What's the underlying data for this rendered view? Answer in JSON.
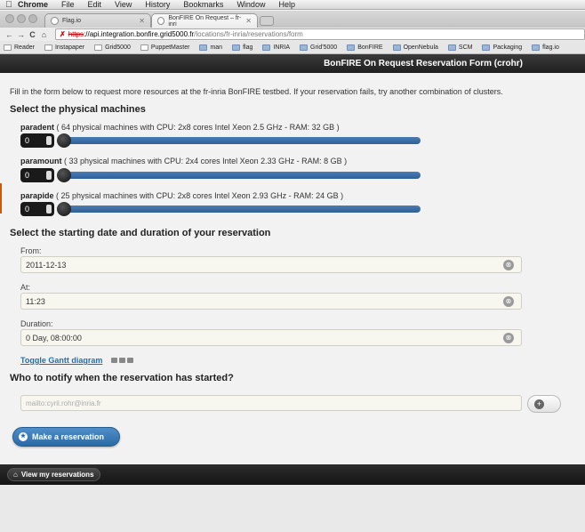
{
  "menubar": {
    "app": "Chrome",
    "items": [
      "File",
      "Edit",
      "View",
      "History",
      "Bookmarks",
      "Window",
      "Help"
    ]
  },
  "tabs": [
    {
      "label": "Flag.io",
      "active": false
    },
    {
      "label": "BonFIRE On Request – fr-inri",
      "active": true
    }
  ],
  "address": {
    "scheme": "https",
    "host": "://api.integration.bonfire.grid5000.fr",
    "path": "/locations/fr-inria/reservations/form"
  },
  "bookmarks": [
    {
      "label": "Reader",
      "icon": "page-icon"
    },
    {
      "label": "Instapaper",
      "icon": "page-icon"
    },
    {
      "label": "Grid5000",
      "icon": "page-icon"
    },
    {
      "label": "PuppetMaster",
      "icon": "page-icon"
    },
    {
      "label": "man",
      "icon": "folder-icon"
    },
    {
      "label": "flag",
      "icon": "folder-icon"
    },
    {
      "label": "INRIA",
      "icon": "folder-icon"
    },
    {
      "label": "Grid'5000",
      "icon": "folder-icon"
    },
    {
      "label": "BonFIRE",
      "icon": "folder-icon"
    },
    {
      "label": "OpenNebula",
      "icon": "folder-icon"
    },
    {
      "label": "SCM",
      "icon": "folder-icon"
    },
    {
      "label": "Packaging",
      "icon": "folder-icon"
    },
    {
      "label": "flag.io",
      "icon": "folder-icon"
    }
  ],
  "header": {
    "title": "BonFIRE On Request Reservation Form (crohr)"
  },
  "intro": "Fill in the form below to request more resources at the fr-inria BonFIRE testbed. If your reservation fails, try another combination of clusters.",
  "machines_section": {
    "title": "Select the physical machines",
    "clusters": [
      {
        "name": "paradent",
        "desc": " ( 64 physical machines with CPU: 2x8 cores Intel Xeon 2.5 GHz - RAM: 32 GB )",
        "value": "0",
        "fraction": 0
      },
      {
        "name": "paramount",
        "desc": " ( 33 physical machines with CPU: 2x4 cores Intel Xeon 2.33 GHz - RAM: 8 GB )",
        "value": "0",
        "fraction": 0
      },
      {
        "name": "parapide",
        "desc": " ( 25 physical machines with CPU: 2x8 cores Intel Xeon 2.93 GHz - RAM: 24 GB )",
        "value": "0",
        "fraction": 0
      }
    ]
  },
  "dates_section": {
    "title": "Select the starting date and duration of your reservation",
    "from_label": "From:",
    "from_value": "2011-12-13",
    "at_label": "At:",
    "at_value": "11:23",
    "duration_label": "Duration:",
    "duration_value": "0 Day, 08:00:00",
    "gantt_link": "Toggle Gantt diagram"
  },
  "notify_section": {
    "title": "Who to notify when the reservation has started?",
    "placeholder": "mailto:cyril.rohr@inria.fr"
  },
  "reserve_button": "Make a reservation",
  "footer": {
    "view_button": "View my reservations"
  },
  "colors": {
    "header_bg": "#1f1f1f",
    "slider": "#2f5f96",
    "link": "#1f6fb0",
    "button": "#2a6aa6"
  }
}
